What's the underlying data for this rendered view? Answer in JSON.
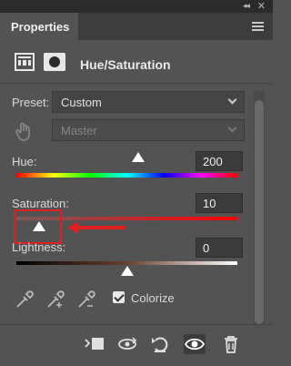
{
  "panel": {
    "tab_label": "Properties",
    "title": "Hue/Saturation"
  },
  "controls": {
    "preset_label": "Preset:",
    "preset_value": "Custom",
    "channel_value": "Master",
    "hue_label": "Hue:",
    "hue_value": "200",
    "saturation_label": "Saturation:",
    "saturation_value": "10",
    "lightness_label": "Lightness:",
    "lightness_value": "0",
    "colorize_label": "Colorize",
    "colorize_checked": true
  },
  "icons": {
    "topbar": [
      "collapse-panels-icon",
      "close-icon"
    ],
    "header": [
      "adjustment-layer-icon",
      "layer-mask-icon"
    ],
    "targeted_adjustment": "hand-icon",
    "eyedroppers": [
      "eyedropper-icon",
      "eyedropper-add-icon",
      "eyedropper-subtract-icon"
    ],
    "bottom": [
      "clip-to-layer-icon",
      "view-previous-state-icon",
      "reset-icon",
      "toggle-visibility-icon",
      "delete-icon"
    ]
  },
  "colors": {
    "panel_bg": "#535353",
    "annotation_red": "#e02020"
  }
}
